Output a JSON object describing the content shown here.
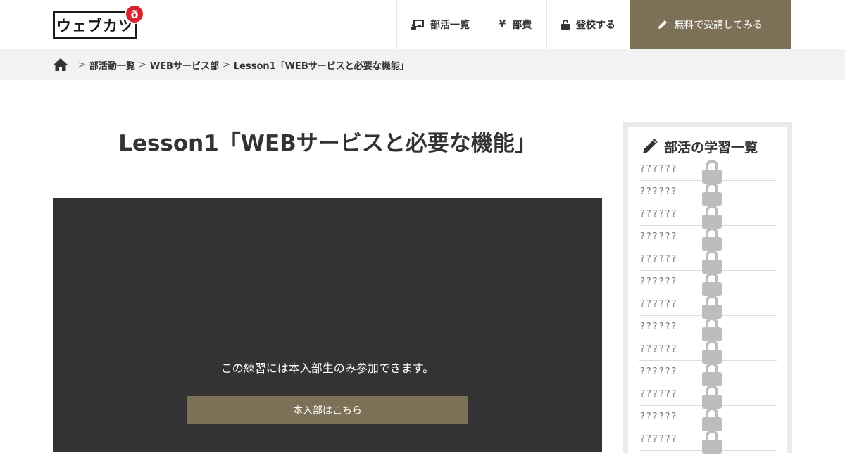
{
  "header": {
    "logo_text": "ウェブカツ",
    "logo_badge": "ð",
    "nav": [
      {
        "label": "部活一覧",
        "icon": "chalkboard-teacher-icon"
      },
      {
        "label": "部費",
        "icon": "yen-icon",
        "glyph": "¥"
      },
      {
        "label": "登校する",
        "icon": "unlock-icon"
      },
      {
        "label": "無料で受講してみる",
        "icon": "pencil-icon"
      }
    ]
  },
  "breadcrumb": {
    "home_icon": "home-icon",
    "sep": ">",
    "items": [
      "部活動一覧",
      "WEBサービス部",
      "Lesson1「WEBサービスと必要な機能」"
    ]
  },
  "page": {
    "title": "Lesson1「WEBサービスと必要な機能」"
  },
  "video": {
    "message": "この練習には本入部生のみ参加できます。",
    "join_label": "本入部はこちら"
  },
  "sidebar": {
    "title": "部活の学習一覧",
    "lessons": [
      "??????",
      "??????",
      "??????",
      "??????",
      "??????",
      "??????",
      "??????",
      "??????",
      "??????",
      "??????",
      "??????",
      "??????",
      "??????"
    ]
  },
  "colors": {
    "accent": "#7c7057",
    "video_bg": "#333333",
    "breadcrumb_bg": "#f2f2f2",
    "logo_badge": "#d9232d",
    "lock": "#bdbdbd"
  }
}
